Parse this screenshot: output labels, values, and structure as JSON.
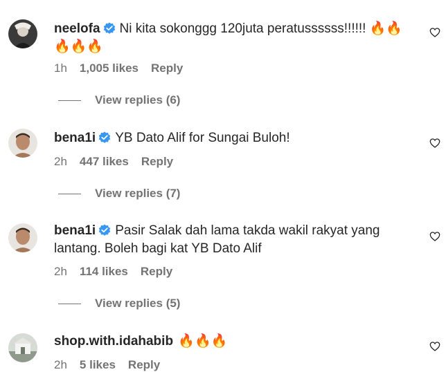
{
  "comments": [
    {
      "username": "neelofa",
      "text": "Ni kita sokonggg 120juta peratussssss!!!!!! 🔥🔥🔥🔥🔥",
      "time": "1h",
      "likes": "1,005 likes",
      "reply_label": "Reply",
      "view_replies": "View replies (6)"
    },
    {
      "username": "bena1i",
      "text": "YB Dato Alif for Sungai Buloh!",
      "time": "2h",
      "likes": "447 likes",
      "reply_label": "Reply",
      "view_replies": "View replies (7)"
    },
    {
      "username": "bena1i",
      "text": "Pasir Salak dah lama takda wakil rakyat yang lantang. Boleh bagi kat YB Dato Alif",
      "time": "2h",
      "likes": "114 likes",
      "reply_label": "Reply",
      "view_replies": "View replies (5)"
    },
    {
      "username": "shop.with.idahabib",
      "text": "🔥🔥🔥",
      "time": "2h",
      "likes": "5 likes",
      "reply_label": "Reply"
    }
  ],
  "colors": {
    "verified": "#3897f0",
    "text": "#262626",
    "secondary": "#737373"
  },
  "icons": {
    "verified": "verified-badge-icon",
    "like": "heart-outline-icon"
  }
}
